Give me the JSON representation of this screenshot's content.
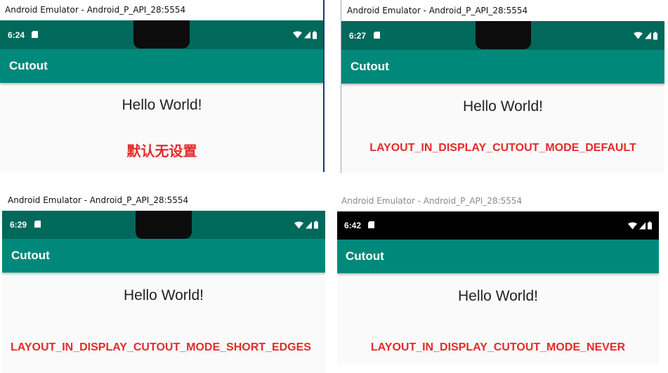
{
  "colors": {
    "teal_dark": "#00695c",
    "teal": "#00897b",
    "black_bar": "#000000",
    "label_red": "#e32b2b",
    "window_divider": "#1f3a6a"
  },
  "panels": [
    {
      "window_title": "Android Emulator - Android_P_API_28:5554",
      "time": "6:24",
      "app_title": "Cutout",
      "hello": "Hello World!",
      "mode_label": "默认无设置",
      "status_icons": [
        "sd-card-icon",
        "wifi-icon",
        "signal-icon",
        "battery-icon"
      ]
    },
    {
      "window_title": "Android Emulator - Android_P_API_28:5554",
      "time": "6:27",
      "app_title": "Cutout",
      "hello": "Hello World!",
      "mode_label": "LAYOUT_IN_DISPLAY_CUTOUT_MODE_DEFAULT",
      "status_icons": [
        "sd-card-icon",
        "wifi-icon",
        "signal-icon",
        "battery-icon"
      ]
    },
    {
      "window_title": "Android Emulator - Android_P_API_28:5554",
      "time": "6:29",
      "app_title": "Cutout",
      "hello": "Hello World!",
      "mode_label": "LAYOUT_IN_DISPLAY_CUTOUT_MODE_SHORT_EDGES",
      "status_icons": [
        "sd-card-icon",
        "wifi-icon",
        "signal-icon",
        "battery-icon"
      ]
    },
    {
      "window_title": "Android Emulator - Android_P_API_28:5554",
      "time": "6:42",
      "app_title": "Cutout",
      "hello": "Hello World!",
      "mode_label": "LAYOUT_IN_DISPLAY_CUTOUT_MODE_NEVER",
      "status_icons": [
        "sd-card-icon",
        "wifi-icon",
        "signal-icon",
        "battery-icon"
      ]
    }
  ]
}
